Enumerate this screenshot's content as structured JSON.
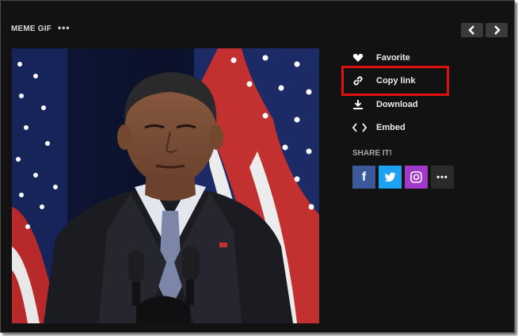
{
  "header": {
    "title": "MEME GIF",
    "more_label": "•••"
  },
  "navigation": {
    "prev_icon": "chevron-left-icon",
    "next_icon": "chevron-right-icon"
  },
  "gif": {
    "description_icon": "gif-preview"
  },
  "actions": [
    {
      "label": "Favorite",
      "icon": "heart-icon"
    },
    {
      "label": "Copy link",
      "icon": "link-icon"
    },
    {
      "label": "Download",
      "icon": "download-icon"
    },
    {
      "label": "Embed",
      "icon": "code-icon"
    }
  ],
  "share": {
    "title": "SHARE IT!",
    "buttons": [
      {
        "label": "f",
        "icon": "facebook-icon",
        "color": "#3b5998"
      },
      {
        "label": "",
        "icon": "twitter-icon",
        "color": "#1da1f2"
      },
      {
        "label": "",
        "icon": "instagram-icon",
        "color": "#a238c9"
      },
      {
        "label": "•••",
        "icon": "more-icon",
        "color": "#2a2a2a"
      }
    ]
  },
  "highlight_color": "#e01010"
}
